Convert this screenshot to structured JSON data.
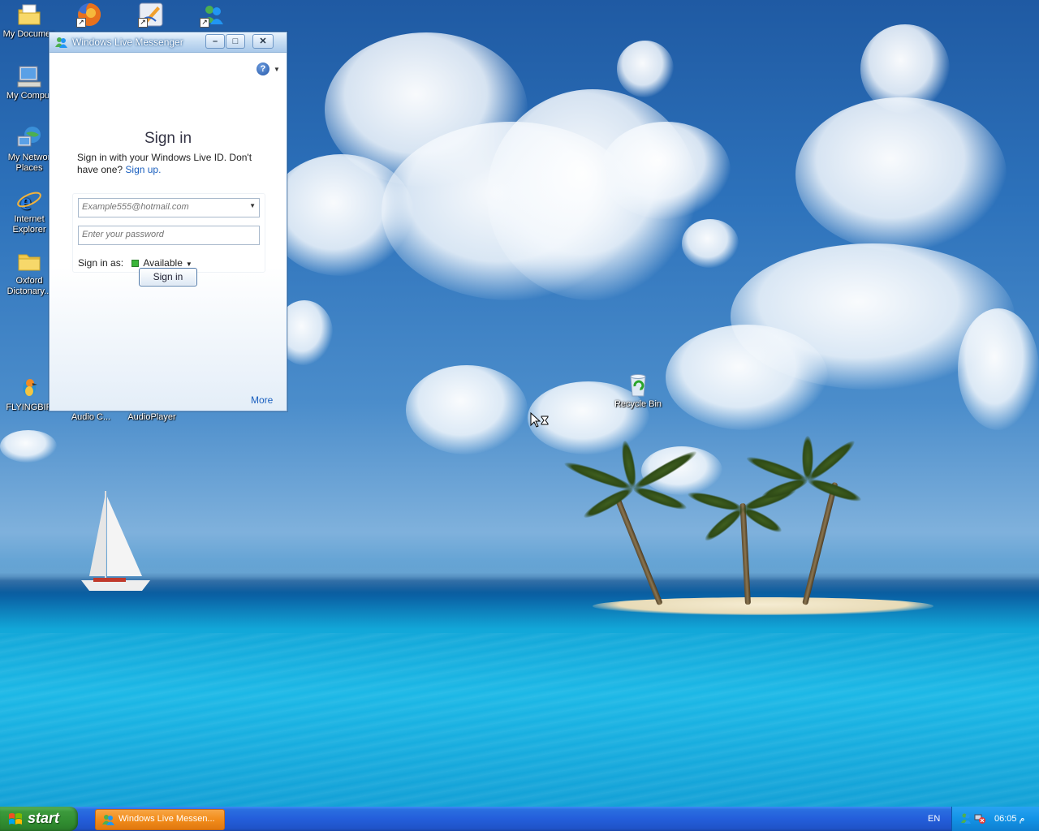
{
  "desktop": {
    "icons": [
      {
        "label": "My Documen"
      },
      {
        "label": "My Comput"
      },
      {
        "label": "My Networ",
        "label2": "Places"
      },
      {
        "label": "Internet",
        "label2": "Explorer"
      },
      {
        "label": "Oxford",
        "label2": "Dictonary..."
      },
      {
        "label": "FLYINGBIR"
      },
      {
        "label": "Audio C..."
      },
      {
        "label": "AudioPlayer"
      },
      {
        "label": "Recycle Bin"
      }
    ]
  },
  "messenger": {
    "title": "Windows Live Messenger",
    "help_label": "?",
    "signin_heading": "Sign in",
    "desc_text": "Sign in with your Windows Live ID. Don't have one?",
    "signup_link": "Sign up.",
    "email_placeholder": "Example555@hotmail.com",
    "password_placeholder": "Enter your password",
    "sign_in_as_label": "Sign in as:",
    "status_value": "Available",
    "signin_button": "Sign in",
    "more_link": "More"
  },
  "taskbar": {
    "start_label": "start",
    "task_button_label": "Windows Live Messen...",
    "language": "EN",
    "clock": "06:05 م"
  },
  "colors": {
    "taskbar_blue": "#245edb",
    "start_green": "#3c9a3c",
    "task_orange": "#f28c1a",
    "link_blue": "#1a5fbf"
  }
}
